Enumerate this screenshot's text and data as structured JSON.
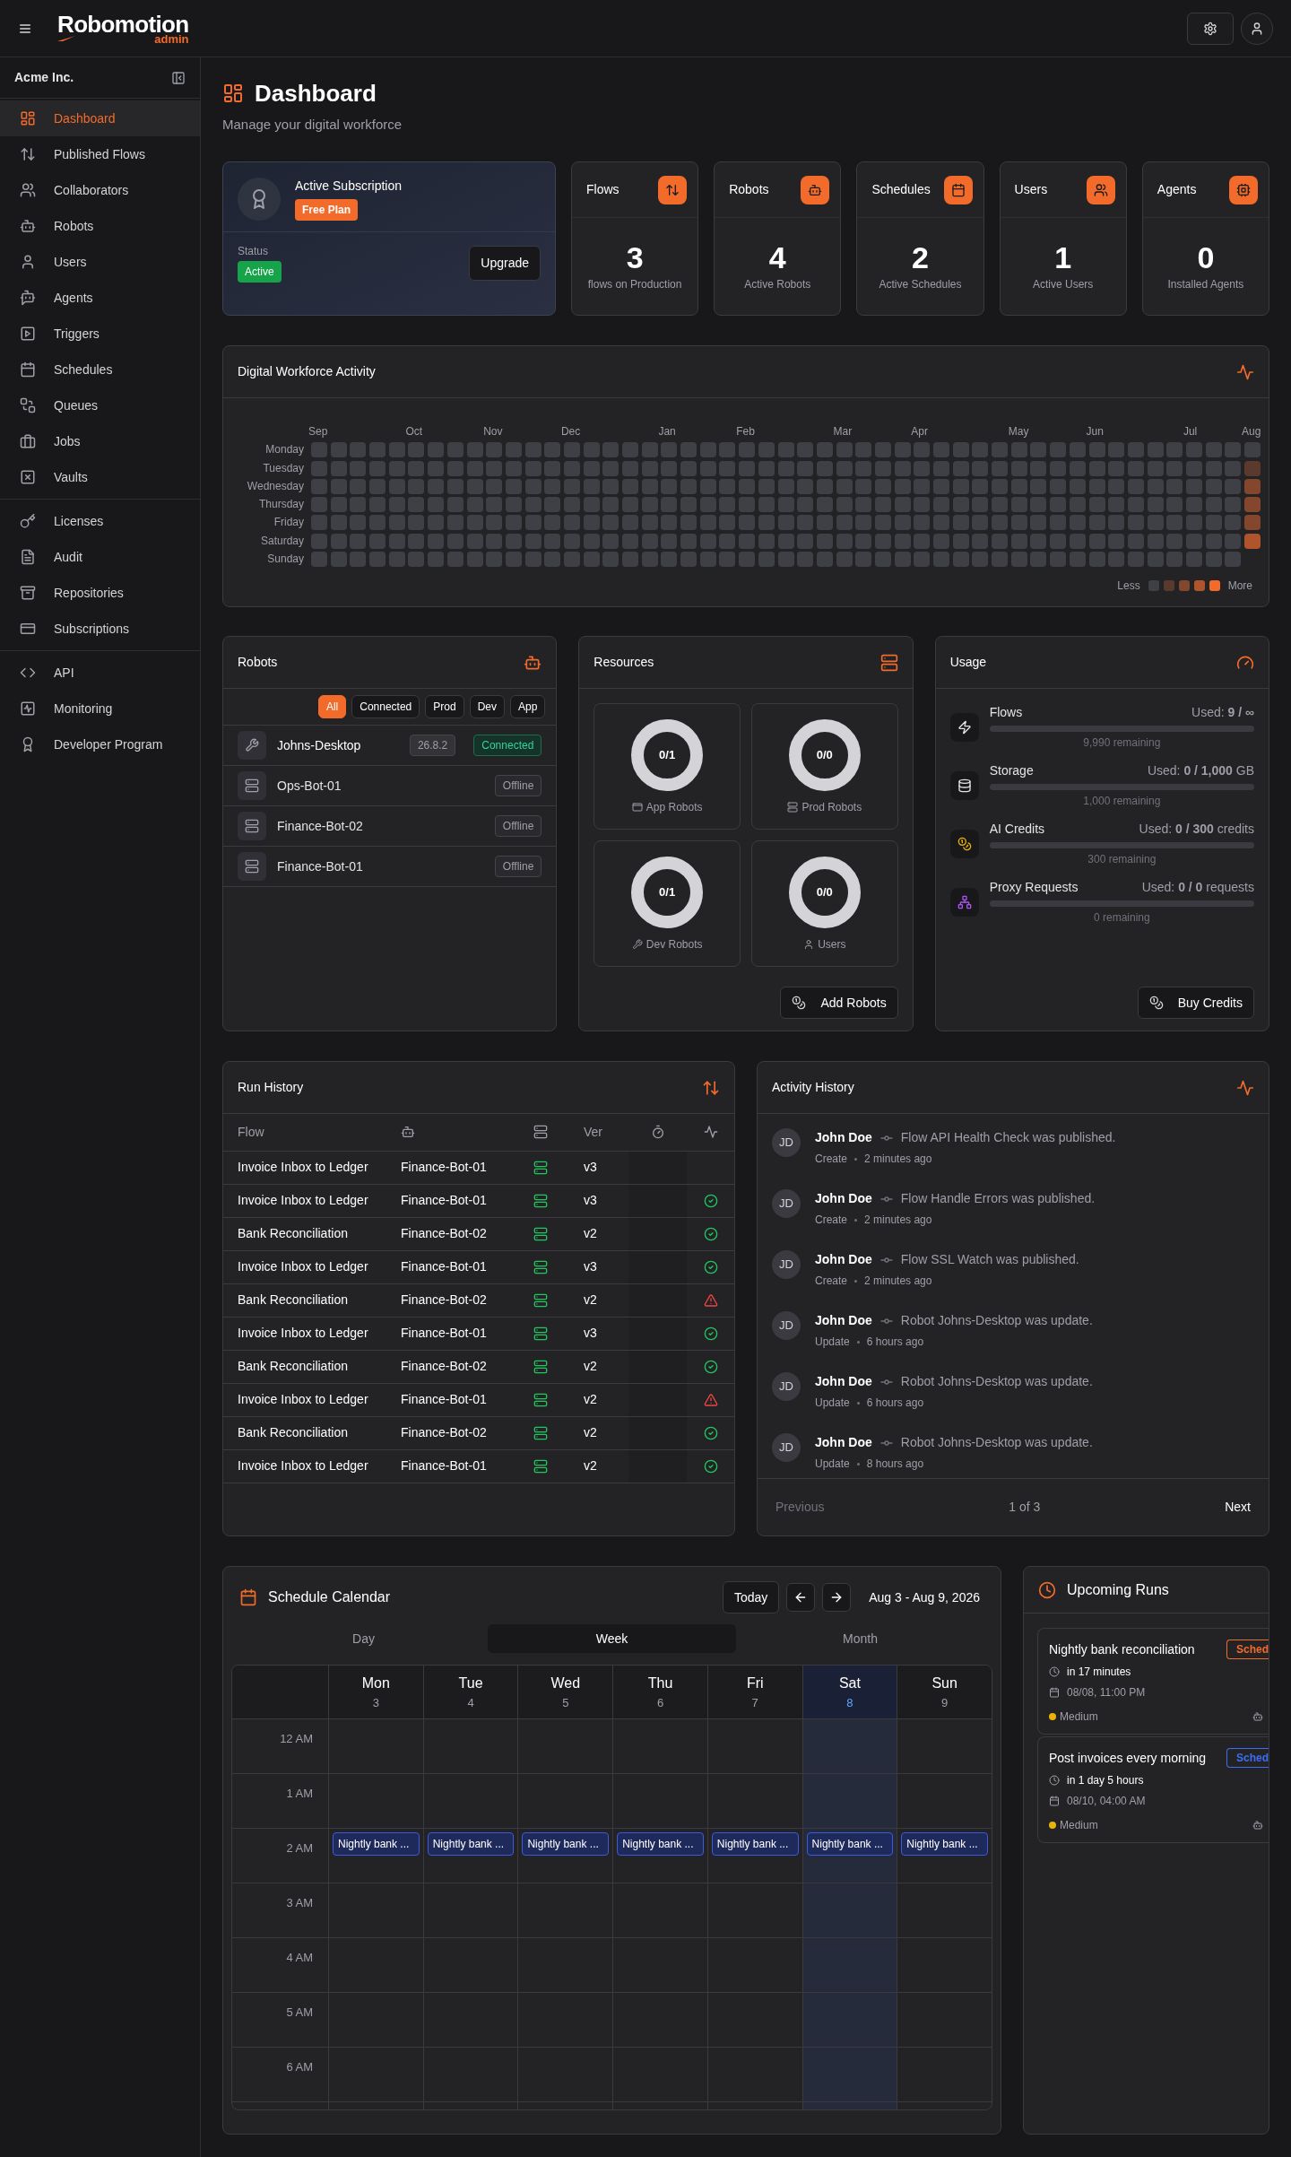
{
  "header": {
    "logo": {
      "name": "Robomotion",
      "suffix": "admin"
    }
  },
  "sidebar": {
    "org": "Acme Inc.",
    "groups": [
      {
        "items": [
          {
            "label": "Dashboard",
            "selected": true
          },
          {
            "label": "Published Flows",
            "selected": false
          },
          {
            "label": "Collaborators",
            "selected": false
          },
          {
            "label": "Robots",
            "selected": false
          },
          {
            "label": "Users",
            "selected": false
          },
          {
            "label": "Agents",
            "selected": false
          },
          {
            "label": "Triggers",
            "selected": false
          },
          {
            "label": "Schedules",
            "selected": false
          },
          {
            "label": "Queues",
            "selected": false
          },
          {
            "label": "Jobs",
            "selected": false
          },
          {
            "label": "Vaults",
            "selected": false
          }
        ]
      },
      {
        "items": [
          {
            "label": "Licenses",
            "selected": false
          },
          {
            "label": "Audit",
            "selected": false
          },
          {
            "label": "Repositories",
            "selected": false
          },
          {
            "label": "Subscriptions",
            "selected": false
          }
        ]
      },
      {
        "items": [
          {
            "label": "API",
            "selected": false
          },
          {
            "label": "Monitoring",
            "selected": false
          },
          {
            "label": "Developer Program",
            "selected": false
          }
        ]
      }
    ]
  },
  "page": {
    "title": "Dashboard",
    "subtitle": "Manage your digital workforce"
  },
  "subscription": {
    "title": "Active Subscription",
    "plan": "Free Plan",
    "status_label": "Status",
    "status": "Active",
    "button": "Upgrade"
  },
  "stats": [
    {
      "title": "Flows",
      "value": "3",
      "caption": "flows on Production"
    },
    {
      "title": "Robots",
      "value": "4",
      "caption": "Active Robots"
    },
    {
      "title": "Schedules",
      "value": "2",
      "caption": "Active Schedules"
    },
    {
      "title": "Users",
      "value": "1",
      "caption": "Active Users"
    },
    {
      "title": "Agents",
      "value": "0",
      "caption": "Installed Agents"
    }
  ],
  "activity": {
    "title": "Digital Workforce Activity",
    "days": [
      "Monday",
      "Tuesday",
      "Wednesday",
      "Thursday",
      "Friday",
      "Saturday",
      "Sunday"
    ],
    "legend": {
      "less": "Less",
      "more": "More"
    },
    "weeks": [
      {
        "month": "Sep",
        "days": [
          {
            "color": "#3f3f46"
          },
          {
            "color": "#3f3f46"
          },
          {
            "color": "#3f3f46"
          },
          {
            "color": "#3f3f46"
          },
          {
            "color": "#3f3f46"
          },
          {
            "color": "#3f3f46"
          },
          {
            "color": "#3f3f46"
          }
        ]
      },
      {
        "days": [
          {
            "color": "#3f3f46"
          },
          {
            "color": "#3f3f46"
          },
          {
            "color": "#3f3f46"
          },
          {
            "color": "#3f3f46"
          },
          {
            "color": "#3f3f46"
          },
          {
            "color": "#3f3f46"
          },
          {
            "color": "#3f3f46"
          }
        ]
      },
      {
        "days": [
          {
            "color": "#3f3f46"
          },
          {
            "color": "#3f3f46"
          },
          {
            "color": "#3f3f46"
          },
          {
            "color": "#3f3f46"
          },
          {
            "color": "#3f3f46"
          },
          {
            "color": "#3f3f46"
          },
          {
            "color": "#3f3f46"
          }
        ]
      },
      {
        "days": [
          {
            "color": "#3f3f46"
          },
          {
            "color": "#3f3f46"
          },
          {
            "color": "#3f3f46"
          },
          {
            "color": "#3f3f46"
          },
          {
            "color": "#3f3f46"
          },
          {
            "color": "#3f3f46"
          },
          {
            "color": "#3f3f46"
          }
        ]
      },
      {
        "days": [
          {
            "color": "#3f3f46"
          },
          {
            "color": "#3f3f46"
          },
          {
            "color": "#3f3f46"
          },
          {
            "color": "#3f3f46"
          },
          {
            "color": "#3f3f46"
          },
          {
            "color": "#3f3f46"
          },
          {
            "color": "#3f3f46"
          }
        ]
      },
      {
        "month": "Oct",
        "days": [
          {
            "color": "#3f3f46"
          },
          {
            "color": "#3f3f46"
          },
          {
            "color": "#3f3f46"
          },
          {
            "color": "#3f3f46"
          },
          {
            "color": "#3f3f46"
          },
          {
            "color": "#3f3f46"
          },
          {
            "color": "#3f3f46"
          }
        ]
      },
      {
        "days": [
          {
            "color": "#3f3f46"
          },
          {
            "color": "#3f3f46"
          },
          {
            "color": "#3f3f46"
          },
          {
            "color": "#3f3f46"
          },
          {
            "color": "#3f3f46"
          },
          {
            "color": "#3f3f46"
          },
          {
            "color": "#3f3f46"
          }
        ]
      },
      {
        "days": [
          {
            "color": "#3f3f46"
          },
          {
            "color": "#3f3f46"
          },
          {
            "color": "#3f3f46"
          },
          {
            "color": "#3f3f46"
          },
          {
            "color": "#3f3f46"
          },
          {
            "color": "#3f3f46"
          },
          {
            "color": "#3f3f46"
          }
        ]
      },
      {
        "days": [
          {
            "color": "#3f3f46"
          },
          {
            "color": "#3f3f46"
          },
          {
            "color": "#3f3f46"
          },
          {
            "color": "#3f3f46"
          },
          {
            "color": "#3f3f46"
          },
          {
            "color": "#3f3f46"
          },
          {
            "color": "#3f3f46"
          }
        ]
      },
      {
        "month": "Nov",
        "days": [
          {
            "color": "#3f3f46"
          },
          {
            "color": "#3f3f46"
          },
          {
            "color": "#3f3f46"
          },
          {
            "color": "#3f3f46"
          },
          {
            "color": "#3f3f46"
          },
          {
            "color": "#3f3f46"
          },
          {
            "color": "#3f3f46"
          }
        ]
      },
      {
        "days": [
          {
            "color": "#3f3f46"
          },
          {
            "color": "#3f3f46"
          },
          {
            "color": "#3f3f46"
          },
          {
            "color": "#3f3f46"
          },
          {
            "color": "#3f3f46"
          },
          {
            "color": "#3f3f46"
          },
          {
            "color": "#3f3f46"
          }
        ]
      },
      {
        "days": [
          {
            "color": "#3f3f46"
          },
          {
            "color": "#3f3f46"
          },
          {
            "color": "#3f3f46"
          },
          {
            "color": "#3f3f46"
          },
          {
            "color": "#3f3f46"
          },
          {
            "color": "#3f3f46"
          },
          {
            "color": "#3f3f46"
          }
        ]
      },
      {
        "days": [
          {
            "color": "#3f3f46"
          },
          {
            "color": "#3f3f46"
          },
          {
            "color": "#3f3f46"
          },
          {
            "color": "#3f3f46"
          },
          {
            "color": "#3f3f46"
          },
          {
            "color": "#3f3f46"
          },
          {
            "color": "#3f3f46"
          }
        ]
      },
      {
        "month": "Dec",
        "days": [
          {
            "color": "#3f3f46"
          },
          {
            "color": "#3f3f46"
          },
          {
            "color": "#3f3f46"
          },
          {
            "color": "#3f3f46"
          },
          {
            "color": "#3f3f46"
          },
          {
            "color": "#3f3f46"
          },
          {
            "color": "#3f3f46"
          }
        ]
      },
      {
        "days": [
          {
            "color": "#3f3f46"
          },
          {
            "color": "#3f3f46"
          },
          {
            "color": "#3f3f46"
          },
          {
            "color": "#3f3f46"
          },
          {
            "color": "#3f3f46"
          },
          {
            "color": "#3f3f46"
          },
          {
            "color": "#3f3f46"
          }
        ]
      },
      {
        "days": [
          {
            "color": "#3f3f46"
          },
          {
            "color": "#3f3f46"
          },
          {
            "color": "#3f3f46"
          },
          {
            "color": "#3f3f46"
          },
          {
            "color": "#3f3f46"
          },
          {
            "color": "#3f3f46"
          },
          {
            "color": "#3f3f46"
          }
        ]
      },
      {
        "days": [
          {
            "color": "#3f3f46"
          },
          {
            "color": "#3f3f46"
          },
          {
            "color": "#3f3f46"
          },
          {
            "color": "#3f3f46"
          },
          {
            "color": "#3f3f46"
          },
          {
            "color": "#3f3f46"
          },
          {
            "color": "#3f3f46"
          }
        ]
      },
      {
        "days": [
          {
            "color": "#3f3f46"
          },
          {
            "color": "#3f3f46"
          },
          {
            "color": "#3f3f46"
          },
          {
            "color": "#3f3f46"
          },
          {
            "color": "#3f3f46"
          },
          {
            "color": "#3f3f46"
          },
          {
            "color": "#3f3f46"
          }
        ]
      },
      {
        "month": "Jan",
        "days": [
          {
            "color": "#3f3f46"
          },
          {
            "color": "#3f3f46"
          },
          {
            "color": "#3f3f46"
          },
          {
            "color": "#3f3f46"
          },
          {
            "color": "#3f3f46"
          },
          {
            "color": "#3f3f46"
          },
          {
            "color": "#3f3f46"
          }
        ]
      },
      {
        "days": [
          {
            "color": "#3f3f46"
          },
          {
            "color": "#3f3f46"
          },
          {
            "color": "#3f3f46"
          },
          {
            "color": "#3f3f46"
          },
          {
            "color": "#3f3f46"
          },
          {
            "color": "#3f3f46"
          },
          {
            "color": "#3f3f46"
          }
        ]
      },
      {
        "days": [
          {
            "color": "#3f3f46"
          },
          {
            "color": "#3f3f46"
          },
          {
            "color": "#3f3f46"
          },
          {
            "color": "#3f3f46"
          },
          {
            "color": "#3f3f46"
          },
          {
            "color": "#3f3f46"
          },
          {
            "color": "#3f3f46"
          }
        ]
      },
      {
        "days": [
          {
            "color": "#3f3f46"
          },
          {
            "color": "#3f3f46"
          },
          {
            "color": "#3f3f46"
          },
          {
            "color": "#3f3f46"
          },
          {
            "color": "#3f3f46"
          },
          {
            "color": "#3f3f46"
          },
          {
            "color": "#3f3f46"
          }
        ]
      },
      {
        "month": "Feb",
        "days": [
          {
            "color": "#3f3f46"
          },
          {
            "color": "#3f3f46"
          },
          {
            "color": "#3f3f46"
          },
          {
            "color": "#3f3f46"
          },
          {
            "color": "#3f3f46"
          },
          {
            "color": "#3f3f46"
          },
          {
            "color": "#3f3f46"
          }
        ]
      },
      {
        "days": [
          {
            "color": "#3f3f46"
          },
          {
            "color": "#3f3f46"
          },
          {
            "color": "#3f3f46"
          },
          {
            "color": "#3f3f46"
          },
          {
            "color": "#3f3f46"
          },
          {
            "color": "#3f3f46"
          },
          {
            "color": "#3f3f46"
          }
        ]
      },
      {
        "days": [
          {
            "color": "#3f3f46"
          },
          {
            "color": "#3f3f46"
          },
          {
            "color": "#3f3f46"
          },
          {
            "color": "#3f3f46"
          },
          {
            "color": "#3f3f46"
          },
          {
            "color": "#3f3f46"
          },
          {
            "color": "#3f3f46"
          }
        ]
      },
      {
        "days": [
          {
            "color": "#3f3f46"
          },
          {
            "color": "#3f3f46"
          },
          {
            "color": "#3f3f46"
          },
          {
            "color": "#3f3f46"
          },
          {
            "color": "#3f3f46"
          },
          {
            "color": "#3f3f46"
          },
          {
            "color": "#3f3f46"
          }
        ]
      },
      {
        "days": [
          {
            "color": "#3f3f46"
          },
          {
            "color": "#3f3f46"
          },
          {
            "color": "#3f3f46"
          },
          {
            "color": "#3f3f46"
          },
          {
            "color": "#3f3f46"
          },
          {
            "color": "#3f3f46"
          },
          {
            "color": "#3f3f46"
          }
        ]
      },
      {
        "month": "Mar",
        "days": [
          {
            "color": "#3f3f46"
          },
          {
            "color": "#3f3f46"
          },
          {
            "color": "#3f3f46"
          },
          {
            "color": "#3f3f46"
          },
          {
            "color": "#3f3f46"
          },
          {
            "color": "#3f3f46"
          },
          {
            "color": "#3f3f46"
          }
        ]
      },
      {
        "days": [
          {
            "color": "#3f3f46"
          },
          {
            "color": "#3f3f46"
          },
          {
            "color": "#3f3f46"
          },
          {
            "color": "#3f3f46"
          },
          {
            "color": "#3f3f46"
          },
          {
            "color": "#3f3f46"
          },
          {
            "color": "#3f3f46"
          }
        ]
      },
      {
        "days": [
          {
            "color": "#3f3f46"
          },
          {
            "color": "#3f3f46"
          },
          {
            "color": "#3f3f46"
          },
          {
            "color": "#3f3f46"
          },
          {
            "color": "#3f3f46"
          },
          {
            "color": "#3f3f46"
          },
          {
            "color": "#3f3f46"
          }
        ]
      },
      {
        "days": [
          {
            "color": "#3f3f46"
          },
          {
            "color": "#3f3f46"
          },
          {
            "color": "#3f3f46"
          },
          {
            "color": "#3f3f46"
          },
          {
            "color": "#3f3f46"
          },
          {
            "color": "#3f3f46"
          },
          {
            "color": "#3f3f46"
          }
        ]
      },
      {
        "month": "Apr",
        "days": [
          {
            "color": "#3f3f46"
          },
          {
            "color": "#3f3f46"
          },
          {
            "color": "#3f3f46"
          },
          {
            "color": "#3f3f46"
          },
          {
            "color": "#3f3f46"
          },
          {
            "color": "#3f3f46"
          },
          {
            "color": "#3f3f46"
          }
        ]
      },
      {
        "days": [
          {
            "color": "#3f3f46"
          },
          {
            "color": "#3f3f46"
          },
          {
            "color": "#3f3f46"
          },
          {
            "color": "#3f3f46"
          },
          {
            "color": "#3f3f46"
          },
          {
            "color": "#3f3f46"
          },
          {
            "color": "#3f3f46"
          }
        ]
      },
      {
        "days": [
          {
            "color": "#3f3f46"
          },
          {
            "color": "#3f3f46"
          },
          {
            "color": "#3f3f46"
          },
          {
            "color": "#3f3f46"
          },
          {
            "color": "#3f3f46"
          },
          {
            "color": "#3f3f46"
          },
          {
            "color": "#3f3f46"
          }
        ]
      },
      {
        "days": [
          {
            "color": "#3f3f46"
          },
          {
            "color": "#3f3f46"
          },
          {
            "color": "#3f3f46"
          },
          {
            "color": "#3f3f46"
          },
          {
            "color": "#3f3f46"
          },
          {
            "color": "#3f3f46"
          },
          {
            "color": "#3f3f46"
          }
        ]
      },
      {
        "days": [
          {
            "color": "#3f3f46"
          },
          {
            "color": "#3f3f46"
          },
          {
            "color": "#3f3f46"
          },
          {
            "color": "#3f3f46"
          },
          {
            "color": "#3f3f46"
          },
          {
            "color": "#3f3f46"
          },
          {
            "color": "#3f3f46"
          }
        ]
      },
      {
        "month": "May",
        "days": [
          {
            "color": "#3f3f46"
          },
          {
            "color": "#3f3f46"
          },
          {
            "color": "#3f3f46"
          },
          {
            "color": "#3f3f46"
          },
          {
            "color": "#3f3f46"
          },
          {
            "color": "#3f3f46"
          },
          {
            "color": "#3f3f46"
          }
        ]
      },
      {
        "days": [
          {
            "color": "#3f3f46"
          },
          {
            "color": "#3f3f46"
          },
          {
            "color": "#3f3f46"
          },
          {
            "color": "#3f3f46"
          },
          {
            "color": "#3f3f46"
          },
          {
            "color": "#3f3f46"
          },
          {
            "color": "#3f3f46"
          }
        ]
      },
      {
        "days": [
          {
            "color": "#3f3f46"
          },
          {
            "color": "#3f3f46"
          },
          {
            "color": "#3f3f46"
          },
          {
            "color": "#3f3f46"
          },
          {
            "color": "#3f3f46"
          },
          {
            "color": "#3f3f46"
          },
          {
            "color": "#3f3f46"
          }
        ]
      },
      {
        "days": [
          {
            "color": "#3f3f46"
          },
          {
            "color": "#3f3f46"
          },
          {
            "color": "#3f3f46"
          },
          {
            "color": "#3f3f46"
          },
          {
            "color": "#3f3f46"
          },
          {
            "color": "#3f3f46"
          },
          {
            "color": "#3f3f46"
          }
        ]
      },
      {
        "month": "Jun",
        "days": [
          {
            "color": "#3f3f46"
          },
          {
            "color": "#3f3f46"
          },
          {
            "color": "#3f3f46"
          },
          {
            "color": "#3f3f46"
          },
          {
            "color": "#3f3f46"
          },
          {
            "color": "#3f3f46"
          },
          {
            "color": "#3f3f46"
          }
        ]
      },
      {
        "days": [
          {
            "color": "#3f3f46"
          },
          {
            "color": "#3f3f46"
          },
          {
            "color": "#3f3f46"
          },
          {
            "color": "#3f3f46"
          },
          {
            "color": "#3f3f46"
          },
          {
            "color": "#3f3f46"
          },
          {
            "color": "#3f3f46"
          }
        ]
      },
      {
        "days": [
          {
            "color": "#3f3f46"
          },
          {
            "color": "#3f3f46"
          },
          {
            "color": "#3f3f46"
          },
          {
            "color": "#3f3f46"
          },
          {
            "color": "#3f3f46"
          },
          {
            "color": "#3f3f46"
          },
          {
            "color": "#3f3f46"
          }
        ]
      },
      {
        "days": [
          {
            "color": "#3f3f46"
          },
          {
            "color": "#3f3f46"
          },
          {
            "color": "#3f3f46"
          },
          {
            "color": "#3f3f46"
          },
          {
            "color": "#3f3f46"
          },
          {
            "color": "#3f3f46"
          },
          {
            "color": "#3f3f46"
          }
        ]
      },
      {
        "days": [
          {
            "color": "#3f3f46"
          },
          {
            "color": "#3f3f46"
          },
          {
            "color": "#3f3f46"
          },
          {
            "color": "#3f3f46"
          },
          {
            "color": "#3f3f46"
          },
          {
            "color": "#3f3f46"
          },
          {
            "color": "#3f3f46"
          }
        ]
      },
      {
        "month": "Jul",
        "days": [
          {
            "color": "#3f3f46"
          },
          {
            "color": "#3f3f46"
          },
          {
            "color": "#3f3f46"
          },
          {
            "color": "#3f3f46"
          },
          {
            "color": "#3f3f46"
          },
          {
            "color": "#3f3f46"
          },
          {
            "color": "#3f3f46"
          }
        ]
      },
      {
        "days": [
          {
            "color": "#3f3f46"
          },
          {
            "color": "#3f3f46"
          },
          {
            "color": "#3f3f46"
          },
          {
            "color": "#3f3f46"
          },
          {
            "color": "#3f3f46"
          },
          {
            "color": "#3f3f46"
          },
          {
            "color": "#3f3f46"
          }
        ]
      },
      {
        "days": [
          {
            "color": "#3f3f46"
          },
          {
            "color": "#3f3f46"
          },
          {
            "color": "#3f3f46"
          },
          {
            "color": "#3f3f46"
          },
          {
            "color": "#3f3f46"
          },
          {
            "color": "#3f3f46"
          },
          {
            "color": "#3f3f46"
          }
        ]
      },
      {
        "month": "Aug",
        "days": [
          {
            "color": "#3f3f46"
          },
          {
            "color": "#5b3a2e"
          },
          {
            "color": "#84462d"
          },
          {
            "color": "#84462d"
          },
          {
            "color": "#84462d"
          },
          {
            "color": "#b0552b"
          }
        ]
      }
    ]
  },
  "robots": {
    "title": "Robots",
    "filters": [
      {
        "label": "All",
        "selected": true
      },
      {
        "label": "Connected",
        "selected": false
      },
      {
        "label": "Prod",
        "selected": false
      },
      {
        "label": "Dev",
        "selected": false
      },
      {
        "label": "App",
        "selected": false
      }
    ],
    "items": [
      {
        "kind": "desktop",
        "name": "Johns-Desktop",
        "version": "26.8.2",
        "status": "Connected",
        "online": true
      },
      {
        "kind": "server",
        "name": "Ops-Bot-01",
        "status": "Offline",
        "online": false
      },
      {
        "kind": "server",
        "name": "Finance-Bot-02",
        "status": "Offline",
        "online": false
      },
      {
        "kind": "server",
        "name": "Finance-Bot-01",
        "status": "Offline",
        "online": false
      }
    ]
  },
  "resources": {
    "title": "Resources",
    "items": [
      {
        "kind": "app",
        "value": "0/1",
        "label": "App Robots"
      },
      {
        "kind": "prod",
        "value": "0/0",
        "label": "Prod Robots"
      },
      {
        "kind": "dev",
        "value": "0/1",
        "label": "Dev Robots"
      },
      {
        "kind": "users",
        "value": "0/0",
        "label": "Users"
      }
    ],
    "button": "Add Robots"
  },
  "usage": {
    "title": "Usage",
    "items": [
      {
        "kind": "flows",
        "name": "Flows",
        "used": "Used: **9 / ∞**",
        "level": 0,
        "remaining": "9,990 remaining"
      },
      {
        "kind": "storage",
        "name": "Storage",
        "used": "Used: **0 / 1,000** GB",
        "level": 0,
        "remaining": "1,000 remaining"
      },
      {
        "kind": "credits",
        "name": "AI Credits",
        "used": "Used: **0 / 300** credits",
        "level": 0,
        "remaining": "300 remaining"
      },
      {
        "kind": "proxy",
        "name": "Proxy Requests",
        "used": "Used: **0 / 0** requests",
        "level": 0,
        "remaining": "0 remaining"
      }
    ],
    "button": "Buy Credits"
  },
  "run_history": {
    "title": "Run History",
    "columns": {
      "flow": "Flow",
      "version": "Ver"
    },
    "rows": [
      {
        "kind": "pending",
        "flow": "Invoice Inbox to Ledger",
        "robot": "Finance-Bot-01",
        "version": "v3"
      },
      {
        "kind": "success",
        "flow": "Invoice Inbox to Ledger",
        "robot": "Finance-Bot-01",
        "version": "v3"
      },
      {
        "kind": "success",
        "flow": "Bank Reconciliation",
        "robot": "Finance-Bot-02",
        "version": "v2"
      },
      {
        "kind": "success",
        "flow": "Invoice Inbox to Ledger",
        "robot": "Finance-Bot-01",
        "version": "v3"
      },
      {
        "kind": "failed",
        "flow": "Bank Reconciliation",
        "robot": "Finance-Bot-02",
        "version": "v2"
      },
      {
        "kind": "success",
        "flow": "Invoice Inbox to Ledger",
        "robot": "Finance-Bot-01",
        "version": "v3"
      },
      {
        "kind": "success",
        "flow": "Bank Reconciliation",
        "robot": "Finance-Bot-02",
        "version": "v2"
      },
      {
        "kind": "failed",
        "flow": "Invoice Inbox to Ledger",
        "robot": "Finance-Bot-01",
        "version": "v2"
      },
      {
        "kind": "success",
        "flow": "Bank Reconciliation",
        "robot": "Finance-Bot-02",
        "version": "v2"
      },
      {
        "kind": "success",
        "flow": "Invoice Inbox to Ledger",
        "robot": "Finance-Bot-01",
        "version": "v2"
      }
    ]
  },
  "activity_history": {
    "title": "Activity History",
    "items": [
      {
        "initials": "JD",
        "user": "John Doe",
        "message": "Flow API Health Check was published.",
        "action": "Create",
        "time": "2 minutes ago"
      },
      {
        "initials": "JD",
        "user": "John Doe",
        "message": "Flow Handle Errors was published.",
        "action": "Create",
        "time": "2 minutes ago"
      },
      {
        "initials": "JD",
        "user": "John Doe",
        "message": "Flow SSL Watch was published.",
        "action": "Create",
        "time": "2 minutes ago"
      },
      {
        "initials": "JD",
        "user": "John Doe",
        "message": "Robot Johns-Desktop was update.",
        "action": "Update",
        "time": "6 hours ago"
      },
      {
        "initials": "JD",
        "user": "John Doe",
        "message": "Robot Johns-Desktop was update.",
        "action": "Update",
        "time": "6 hours ago"
      },
      {
        "initials": "JD",
        "user": "John Doe",
        "message": "Robot Johns-Desktop was update.",
        "action": "Update",
        "time": "8 hours ago"
      }
    ],
    "pagination": {
      "previous": {
        "label": "Previous",
        "disabled": true
      },
      "page": "1 of 3",
      "next": {
        "label": "Next",
        "disabled": false
      }
    }
  },
  "calendar": {
    "title": "Schedule Calendar",
    "today": "Today",
    "range": "Aug 3 - Aug 9, 2026",
    "views": [
      {
        "label": "Day",
        "selected": false
      },
      {
        "label": "Week",
        "selected": true
      },
      {
        "label": "Month",
        "selected": false
      }
    ],
    "days": [
      {
        "name": "Mon",
        "date": "3",
        "selected": false
      },
      {
        "name": "Tue",
        "date": "4",
        "selected": false
      },
      {
        "name": "Wed",
        "date": "5",
        "selected": false
      },
      {
        "name": "Thu",
        "date": "6",
        "selected": false
      },
      {
        "name": "Fri",
        "date": "7",
        "selected": false
      },
      {
        "name": "Sat",
        "date": "8",
        "selected": true
      },
      {
        "name": "Sun",
        "date": "9",
        "selected": false
      }
    ],
    "hours": [
      {
        "label": "12 AM"
      },
      {
        "label": "1 AM"
      },
      {
        "label": "2 AM",
        "events": [
          {
            "title": "Nightly bank ..."
          },
          {
            "title": "Nightly bank ..."
          },
          {
            "title": "Nightly bank ..."
          },
          {
            "title": "Nightly bank ..."
          },
          {
            "title": "Nightly bank ..."
          },
          {
            "title": "Nightly bank ..."
          },
          {
            "title": "Nightly bank ..."
          }
        ]
      },
      {
        "label": "3 AM"
      },
      {
        "label": "4 AM"
      },
      {
        "label": "5 AM"
      },
      {
        "label": "6 AM"
      }
    ]
  },
  "upcoming_runs": {
    "title": "Upcoming Runs",
    "items": [
      {
        "title": "Nightly bank reconciliation",
        "badge": "Sched",
        "color": "#f26b2a",
        "due": "in 17 minutes",
        "date": "08/08, 11:00 PM",
        "priority": {
          "label": "Medium",
          "color": "#eab308"
        }
      },
      {
        "title": "Post invoices every morning",
        "badge": "Sched",
        "color": "#3b6ef5",
        "due": "in 1 day 5 hours",
        "date": "08/10, 04:00 AM",
        "priority": {
          "label": "Medium",
          "color": "#eab308"
        }
      }
    ]
  }
}
